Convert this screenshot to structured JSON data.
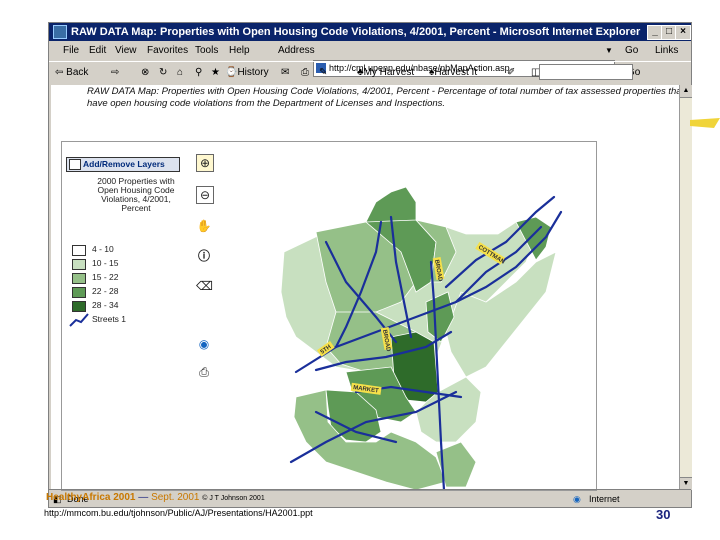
{
  "window": {
    "title": "RAW DATA Map: Properties with Open Housing Code Violations, 4/2001, Percent - Microsoft Internet Explorer",
    "controls": [
      "_",
      "□",
      "×"
    ]
  },
  "menubar": {
    "items": [
      "File",
      "Edit",
      "View",
      "Favorites",
      "Tools",
      "Help"
    ],
    "address_label": "Address",
    "address_value": "http://cml.upenn.edu/nbase/nbMapAction.asp",
    "go_label": "Go",
    "links_label": "Links"
  },
  "toolbar": {
    "back": "Back",
    "history": "History",
    "my_harvest": "My Harvest",
    "harvest_it": "Harvest It",
    "go_label": "Go"
  },
  "content": {
    "header": "RAW DATA Map: Properties with Open Housing Code Violations, 4/2001, Percent - Percentage of total number of tax assessed properties that have open housing code violations from the Department of Licenses and Inspections."
  },
  "legend": {
    "button_label": "Add/Remove Layers",
    "layer_title": "2000 Properties with Open Housing Code Violations, 4/2001, Percent",
    "classes": [
      {
        "label": "4 - 10",
        "color": "#ffffff"
      },
      {
        "label": "10 - 15",
        "color": "#c8e0c0"
      },
      {
        "label": "15 - 22",
        "color": "#95c088"
      },
      {
        "label": "22 - 28",
        "color": "#5e9a56"
      },
      {
        "label": "28 - 34",
        "color": "#2e6b2a"
      }
    ],
    "streets_label": "Streets 1"
  },
  "map": {
    "street_labels": [
      "COTTMAN",
      "BROAD",
      "5TH",
      "MARKET"
    ]
  },
  "tools": [
    "zoom-in-icon",
    "zoom-out-icon",
    "pan-hand-icon",
    "info-icon",
    "eraser-icon",
    "globe-icon",
    "print-icon"
  ],
  "statusbar": {
    "left": "Done",
    "zone": "Internet"
  },
  "footer": {
    "brand": "HealthyAfrica 2001",
    "dash": " — ",
    "date": "Sept. 2001",
    "credit": "© J T Johnson 2001",
    "url": "http://mmcom.bu.edu/tjohnson/Public/AJ/Presentations/HA2001.ppt",
    "page": "30"
  }
}
